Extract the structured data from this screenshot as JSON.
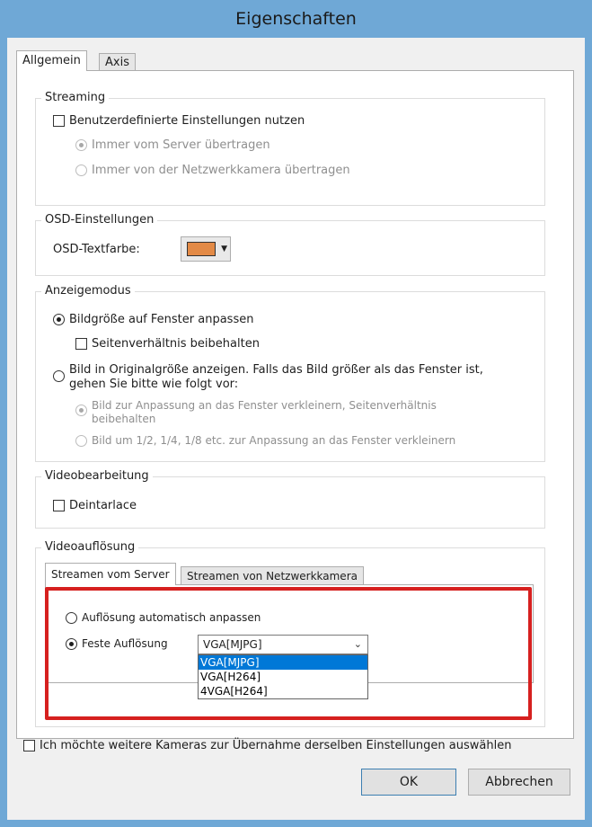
{
  "window": {
    "title": "Eigenschaften"
  },
  "tabs": [
    {
      "label": "Allgemein",
      "active": true
    },
    {
      "label": "Axis",
      "active": false
    }
  ],
  "streaming": {
    "legend": "Streaming",
    "custom_checkbox_label": "Benutzerdefinierte Einstellungen nutzen",
    "custom_checked": false,
    "radio_server_label": "Immer vom Server übertragen",
    "radio_server_selected": true,
    "radio_camera_label": "Immer von der Netzwerkkamera übertragen",
    "radio_camera_selected": false
  },
  "osd": {
    "legend": "OSD-Einstellungen",
    "text_color_label": "OSD-Textfarbe:",
    "text_color": "#e38a46"
  },
  "display_mode": {
    "legend": "Anzeigemodus",
    "fit_window_label": "Bildgröße auf Fenster anpassen",
    "fit_window_selected": true,
    "keep_aspect_label": "Seitenverhältnis beibehalten",
    "keep_aspect_checked": false,
    "original_size_label_line1": "Bild in Originalgröße anzeigen. Falls das Bild größer als das Fenster ist,",
    "original_size_label_line2": "gehen Sie bitte wie folgt vor:",
    "original_size_selected": false,
    "shrink_keep_aspect_label_line1": "Bild zur Anpassung an das Fenster verkleinern, Seitenverhältnis",
    "shrink_keep_aspect_label_line2": "beibehalten",
    "shrink_keep_aspect_selected": true,
    "shrink_fraction_label": "Bild um 1/2, 1/4, 1/8 etc. zur Anpassung an das Fenster verkleinern",
    "shrink_fraction_selected": false
  },
  "video_processing": {
    "legend": "Videobearbeitung",
    "deinterlace_label": "Deintarlace",
    "deinterlace_checked": false
  },
  "video_resolution": {
    "legend": "Videoauflösung",
    "subtabs": [
      {
        "label": "Streamen vom Server",
        "active": true
      },
      {
        "label": "Streamen von Netzwerkkamera",
        "active": false
      }
    ],
    "auto_label": "Auflösung automatisch anpassen",
    "auto_selected": false,
    "fixed_label": "Feste Auflösung",
    "fixed_selected": true,
    "selected_value": "VGA[MJPG]",
    "options": [
      "VGA[MJPG]",
      "VGA[H264]",
      "4VGA[H264]"
    ],
    "highlighted_option_index": 0
  },
  "footer": {
    "apply_other_cameras_label": "Ich möchte weitere Kameras zur Übernahme derselben Einstellungen auswählen",
    "apply_other_cameras_checked": false,
    "ok_label": "OK",
    "cancel_label": "Abbrechen"
  },
  "colors": {
    "window_frame": "#6fa8d6",
    "highlight_box": "#d6201f",
    "selection": "#0078d7"
  }
}
